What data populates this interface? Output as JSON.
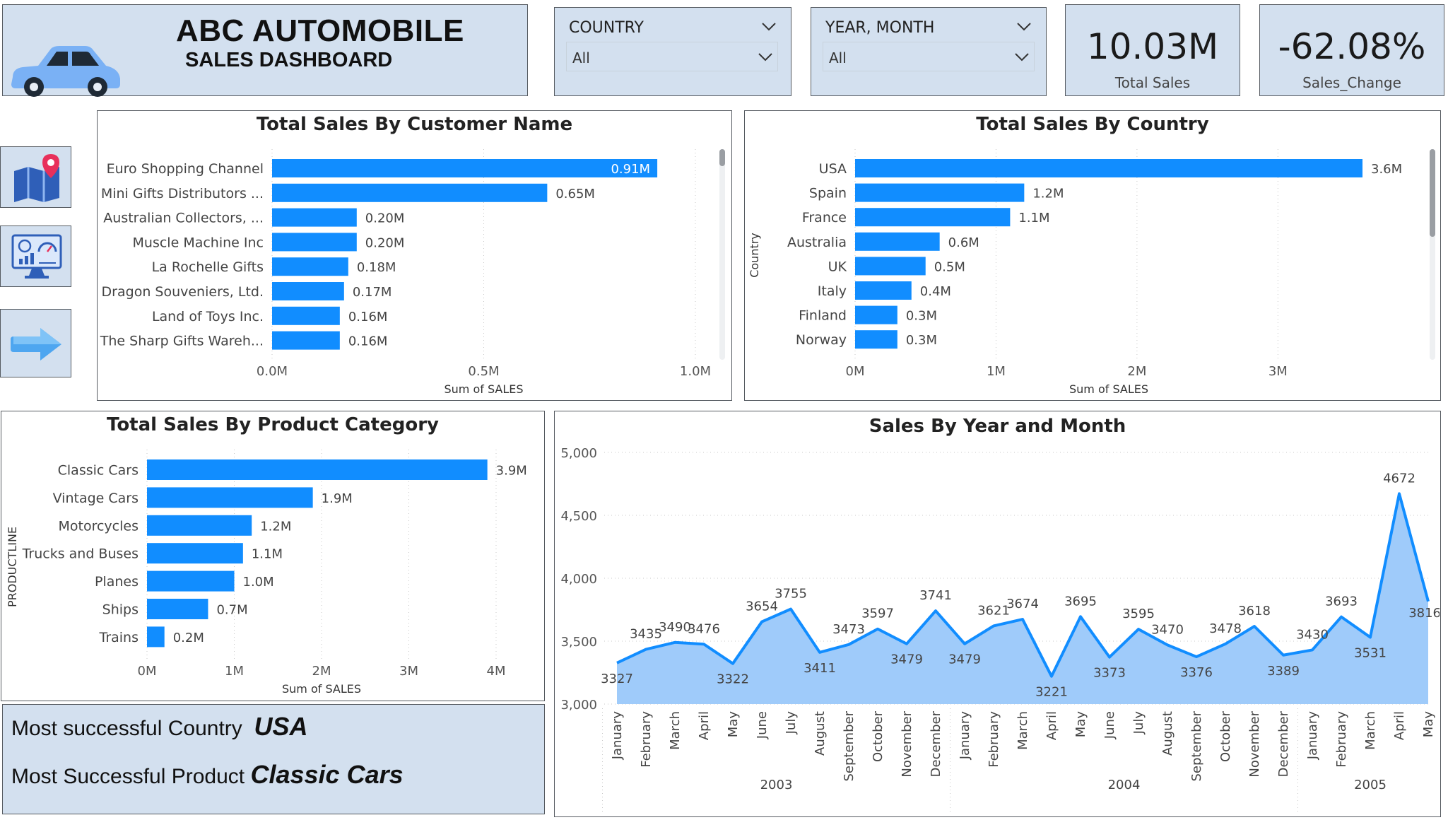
{
  "header": {
    "title": "ABC AUTOMOBILE",
    "subtitle": "SALES DASHBOARD",
    "logo_icon": "car-icon"
  },
  "filters": {
    "country": {
      "label": "COUNTRY",
      "value": "All"
    },
    "year_month": {
      "label": "YEAR, MONTH",
      "value": "All"
    }
  },
  "kpis": {
    "total_sales": {
      "value": "10.03M",
      "label": "Total Sales"
    },
    "sales_change": {
      "value": "-62.08%",
      "label": "Sales_Change"
    }
  },
  "nav": {
    "items": [
      {
        "icon": "map-pin-icon"
      },
      {
        "icon": "dashboard-monitor-icon"
      },
      {
        "icon": "arrow-right-icon"
      }
    ]
  },
  "colors": {
    "bar": "#118dff",
    "area": "#9fcbfa",
    "line": "#118dff",
    "tile": "#d3e0ef"
  },
  "summary": {
    "country_label": "Most successful Country",
    "country_value": "USA",
    "product_label": "Most Successful Product",
    "product_value": "Classic Cars"
  },
  "chart_data": [
    {
      "id": "customer",
      "type": "bar",
      "orientation": "horizontal",
      "title": "Total Sales By Customer Name",
      "xlabel": "Sum of SALES",
      "ylabel": "",
      "categories": [
        "Euro Shopping Channel",
        "Mini Gifts Distributors ...",
        "Australian Collectors, ...",
        "Muscle Machine Inc",
        "La Rochelle Gifts",
        "Dragon Souveniers, Ltd.",
        "Land of Toys Inc.",
        "The Sharp Gifts Wareh..."
      ],
      "values": [
        0.91,
        0.65,
        0.2,
        0.2,
        0.18,
        0.17,
        0.16,
        0.16
      ],
      "value_labels": [
        "0.91M",
        "0.65M",
        "0.20M",
        "0.20M",
        "0.18M",
        "0.17M",
        "0.16M",
        "0.16M"
      ],
      "xlim": [
        0,
        1.0
      ],
      "ticks": [
        0,
        0.5,
        1.0
      ],
      "tick_labels": [
        "0.0M",
        "0.5M",
        "1.0M"
      ]
    },
    {
      "id": "country",
      "type": "bar",
      "orientation": "horizontal",
      "title": "Total Sales By Country",
      "xlabel": "Sum of SALES",
      "ylabel": "Country",
      "categories": [
        "USA",
        "Spain",
        "France",
        "Australia",
        "UK",
        "Italy",
        "Finland",
        "Norway"
      ],
      "values": [
        3.6,
        1.2,
        1.1,
        0.6,
        0.5,
        0.4,
        0.3,
        0.3
      ],
      "value_labels": [
        "3.6M",
        "1.2M",
        "1.1M",
        "0.6M",
        "0.5M",
        "0.4M",
        "0.3M",
        "0.3M"
      ],
      "xlim": [
        0,
        3.6
      ],
      "ticks": [
        0,
        1,
        2,
        3
      ],
      "tick_labels": [
        "0M",
        "1M",
        "2M",
        "3M"
      ]
    },
    {
      "id": "product",
      "type": "bar",
      "orientation": "horizontal",
      "title": "Total Sales By Product Category",
      "xlabel": "Sum of SALES",
      "ylabel": "PRODUCTLINE",
      "categories": [
        "Classic Cars",
        "Vintage Cars",
        "Motorcycles",
        "Trucks and Buses",
        "Planes",
        "Ships",
        "Trains"
      ],
      "values": [
        3.9,
        1.9,
        1.2,
        1.1,
        1.0,
        0.7,
        0.2
      ],
      "value_labels": [
        "3.9M",
        "1.9M",
        "1.2M",
        "1.1M",
        "1.0M",
        "0.7M",
        "0.2M"
      ],
      "xlim": [
        0,
        4
      ],
      "ticks": [
        0,
        1,
        2,
        3,
        4
      ],
      "tick_labels": [
        "0M",
        "1M",
        "2M",
        "3M",
        "4M"
      ]
    },
    {
      "id": "timeline",
      "type": "area",
      "title": "Sales By Year and Month",
      "ylim": [
        3000,
        5000
      ],
      "yticks": [
        3000,
        3500,
        4000,
        4500,
        5000
      ],
      "ytick_labels": [
        "3,000",
        "3,500",
        "4,000",
        "4,500",
        "5,000"
      ],
      "months": [
        "January",
        "February",
        "March",
        "April",
        "May",
        "June",
        "July",
        "August",
        "September",
        "October",
        "November",
        "December",
        "January",
        "February",
        "March",
        "April",
        "May",
        "June",
        "July",
        "August",
        "September",
        "October",
        "November",
        "December",
        "January",
        "February",
        "March",
        "April",
        "May"
      ],
      "years": [
        {
          "label": "2003",
          "start": 0,
          "end": 11
        },
        {
          "label": "2004",
          "start": 12,
          "end": 23
        },
        {
          "label": "2005",
          "start": 24,
          "end": 28
        }
      ],
      "values": [
        3327,
        3435,
        3490,
        3476,
        3322,
        3654,
        3755,
        3411,
        3473,
        3597,
        3479,
        3741,
        3479,
        3621,
        3674,
        3221,
        3695,
        3373,
        3595,
        3470,
        3376,
        3478,
        3618,
        3389,
        3430,
        3693,
        3531,
        4672,
        3816
      ]
    }
  ]
}
